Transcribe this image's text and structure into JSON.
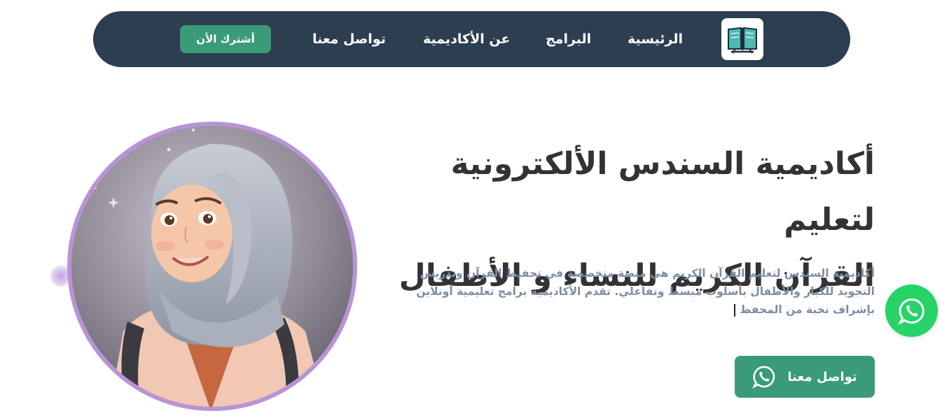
{
  "nav": {
    "logo_icon": "open-book-icon",
    "links": [
      "الرئيسية",
      "البرامج",
      "عن الأكاديمية",
      "تواصل معنا"
    ],
    "cta_label": "أشترك الأن"
  },
  "hero": {
    "title_line1": "أكاديمية السندس الألكترونية لتعليم",
    "title_line2": "القرآن الكريم للنساء و الأطفال",
    "description_line1": "أكاديمية السندس لتعليم القرآن الكريم هي منصة متخصصة في تحفيظ القرآن وتدريس",
    "description_line2": "التجويد للكبار والأطفال بأسلوب مبسط وتفاعلي. تقدم الأكاديمية برامج تعليمية أونلاين",
    "description_line3": "بإشراف نخبة من المحفظ",
    "contact_label": "تواصل معنا",
    "contact_icon": "whatsapp-icon"
  },
  "floating": {
    "icon": "whatsapp-icon"
  },
  "colors": {
    "navbar_bg": "#2c3e50",
    "accent_green": "#3a9b78",
    "whatsapp_green": "#25d366",
    "portrait_ring": "#b894d6"
  }
}
